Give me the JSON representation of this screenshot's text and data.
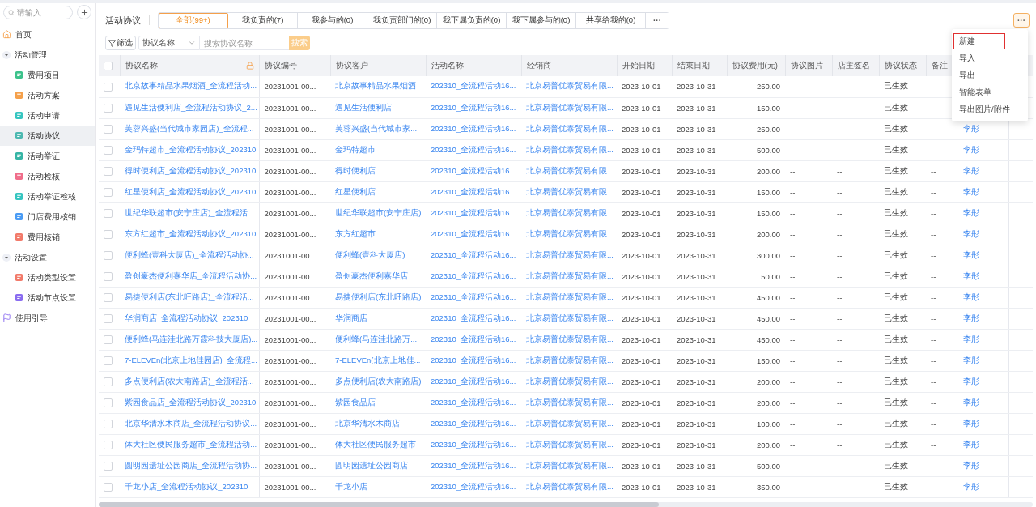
{
  "sidebar": {
    "search": {
      "placeholder": "请输入"
    },
    "items": [
      {
        "kind": "home",
        "label": "首页",
        "selected": false
      },
      {
        "kind": "group",
        "label": "活动管理",
        "expanded": true,
        "children": [
          {
            "label": "费用项目",
            "color": "#3cc28b",
            "selected": false
          },
          {
            "label": "活动方案",
            "color": "#f5a04a",
            "selected": false
          },
          {
            "label": "活动申请",
            "color": "#36c5c0",
            "selected": false
          },
          {
            "label": "活动协议",
            "color": "#4bb8b0",
            "selected": true
          },
          {
            "label": "活动举证",
            "color": "#36b5a5",
            "selected": false
          },
          {
            "label": "活动检核",
            "color": "#f06d8a",
            "selected": false
          },
          {
            "label": "活动举证检核",
            "color": "#36c5c0",
            "selected": false
          },
          {
            "label": "门店费用核销",
            "color": "#4a9cf5",
            "selected": false
          },
          {
            "label": "费用核销",
            "color": "#f27a6a",
            "selected": false
          }
        ]
      },
      {
        "kind": "group",
        "label": "活动设置",
        "expanded": true,
        "children": [
          {
            "label": "活动类型设置",
            "color": "#f27a6a",
            "selected": false
          },
          {
            "label": "活动节点设置",
            "color": "#8a6cf0",
            "selected": false
          }
        ]
      },
      {
        "kind": "guide",
        "label": "使用引导",
        "selected": false
      }
    ]
  },
  "header": {
    "title": "活动协议",
    "tabs": [
      {
        "label": "全部(99+)",
        "selected": true
      },
      {
        "label": "我负责的(7)",
        "selected": false
      },
      {
        "label": "我参与的(0)",
        "selected": false
      },
      {
        "label": "我负责部门的(0)",
        "selected": false
      },
      {
        "label": "我下属负责的(0)",
        "selected": false
      },
      {
        "label": "我下属参与的(0)",
        "selected": false
      },
      {
        "label": "共享给我的(0)",
        "selected": false
      }
    ],
    "more_tab": "···",
    "more_button": {
      "label": "···",
      "active": true
    }
  },
  "menu": {
    "items": [
      {
        "label": "新建",
        "highlighted": true
      },
      {
        "label": "导入",
        "highlighted": false
      },
      {
        "label": "导出",
        "highlighted": false
      },
      {
        "label": "智能表单",
        "highlighted": false
      },
      {
        "label": "导出图片/附件",
        "highlighted": false
      }
    ]
  },
  "filter": {
    "filter_button": "筛选",
    "field_select": "协议名称",
    "search": {
      "placeholder": "搜索协议名称"
    },
    "search_button": "搜索"
  },
  "table": {
    "header_checked": false,
    "columns": [
      {
        "label": "协议名称",
        "kind": "link",
        "locked": true
      },
      {
        "label": "协议编号",
        "kind": "text"
      },
      {
        "label": "协议客户",
        "kind": "link"
      },
      {
        "label": "活动名称",
        "kind": "link"
      },
      {
        "label": "经销商",
        "kind": "link"
      },
      {
        "label": "开始日期",
        "kind": "text"
      },
      {
        "label": "结束日期",
        "kind": "text"
      },
      {
        "label": "协议费用(元)",
        "kind": "number"
      },
      {
        "label": "协议图片",
        "kind": "text"
      },
      {
        "label": "店主签名",
        "kind": "text"
      },
      {
        "label": "协议状态",
        "kind": "text"
      },
      {
        "label": "备注",
        "kind": "text"
      }
    ],
    "rows": [
      {
        "checked": false,
        "cells": [
          "北京故事精品水果烟酒_全流程活动...",
          "20231001-00...",
          "北京故事精品水果烟酒",
          "202310_全流程活动16...",
          "北京易普优泰贸易有限...",
          "2023-10-01",
          "2023-10-31",
          "250.00",
          "--",
          "--",
          "已生效",
          "--"
        ]
      },
      {
        "checked": false,
        "cells": [
          "遇见生活便利店_全流程活动协议_2...",
          "20231001-00...",
          "遇见生活便利店",
          "202310_全流程活动16...",
          "北京易普优泰贸易有限...",
          "2023-10-01",
          "2023-10-31",
          "150.00",
          "--",
          "--",
          "已生效",
          "--"
        ]
      },
      {
        "checked": false,
        "cells": [
          "芙蓉兴盛(当代城市家园店)_全流程...",
          "20231001-00...",
          "芙蓉兴盛(当代城市家...",
          "202310_全流程活动16...",
          "北京易普优泰贸易有限...",
          "2023-10-01",
          "2023-10-31",
          "250.00",
          "--",
          "--",
          "已生效",
          "--"
        ],
        "column_14": "李彤"
      },
      {
        "checked": false,
        "cells": [
          "金玛特超市_全流程活动协议_202310",
          "20231001-00...",
          "金玛特超市",
          "202310_全流程活动16...",
          "北京易普优泰贸易有限...",
          "2023-10-01",
          "2023-10-31",
          "500.00",
          "--",
          "--",
          "已生效",
          "--"
        ],
        "column_14": "李彤"
      },
      {
        "checked": false,
        "cells": [
          "得时便利店_全流程活动协议_202310",
          "20231001-00...",
          "得时便利店",
          "202310_全流程活动16...",
          "北京易普优泰贸易有限...",
          "2023-10-01",
          "2023-10-31",
          "200.00",
          "--",
          "--",
          "已生效",
          "--"
        ],
        "column_14": "李彤"
      },
      {
        "checked": false,
        "cells": [
          "红星便利店_全流程活动协议_202310",
          "20231001-00...",
          "红星便利店",
          "202310_全流程活动16...",
          "北京易普优泰贸易有限...",
          "2023-10-01",
          "2023-10-31",
          "150.00",
          "--",
          "--",
          "已生效",
          "--"
        ],
        "column_14": "李彤"
      },
      {
        "checked": false,
        "cells": [
          "世纪华联超市(安宁庄店)_全流程活...",
          "20231001-00...",
          "世纪华联超市(安宁庄店)",
          "202310_全流程活动16...",
          "北京易普优泰贸易有限...",
          "2023-10-01",
          "2023-10-31",
          "150.00",
          "--",
          "--",
          "已生效",
          "--"
        ],
        "column_14": "李彤"
      },
      {
        "checked": false,
        "cells": [
          "东方红超市_全流程活动协议_202310",
          "20231001-00...",
          "东方红超市",
          "202310_全流程活动16...",
          "北京易普优泰贸易有限...",
          "2023-10-01",
          "2023-10-31",
          "200.00",
          "--",
          "--",
          "已生效",
          "--"
        ],
        "column_14": "李彤"
      },
      {
        "checked": false,
        "cells": [
          "便利蜂(壹科大厦店)_全流程活动协...",
          "20231001-00...",
          "便利蜂(壹科大厦店)",
          "202310_全流程活动16...",
          "北京易普优泰贸易有限...",
          "2023-10-01",
          "2023-10-31",
          "300.00",
          "--",
          "--",
          "已生效",
          "--"
        ],
        "column_14": "李彤"
      },
      {
        "checked": false,
        "cells": [
          "盈创豪杰便利嘉华店_全流程活动协...",
          "20231001-00...",
          "盈创豪杰便利嘉华店",
          "202310_全流程活动16...",
          "北京易普优泰贸易有限...",
          "2023-10-01",
          "2023-10-31",
          "50.00",
          "--",
          "--",
          "已生效",
          "--"
        ],
        "column_14": "李彤"
      },
      {
        "checked": false,
        "cells": [
          "易捷便利店(东北旺路店)_全流程活...",
          "20231001-00...",
          "易捷便利店(东北旺路店)",
          "202310_全流程活动16...",
          "北京易普优泰贸易有限...",
          "2023-10-01",
          "2023-10-31",
          "450.00",
          "--",
          "--",
          "已生效",
          "--"
        ],
        "column_14": "李彤"
      },
      {
        "checked": false,
        "cells": [
          "华润商店_全流程活动协议_202310",
          "20231001-00...",
          "华润商店",
          "202310_全流程活动16...",
          "北京易普优泰贸易有限...",
          "2023-10-01",
          "2023-10-31",
          "450.00",
          "--",
          "--",
          "已生效",
          "--"
        ],
        "column_14": "李彤"
      },
      {
        "checked": false,
        "cells": [
          "便利蜂(马连洼北路万霞科技大厦店)...",
          "20231001-00...",
          "便利蜂(马连洼北路万...",
          "202310_全流程活动16...",
          "北京易普优泰贸易有限...",
          "2023-10-01",
          "2023-10-31",
          "450.00",
          "--",
          "--",
          "已生效",
          "--"
        ],
        "column_14": "李彤"
      },
      {
        "checked": false,
        "cells": [
          "7-ELEVEn(北京上地佳园店)_全流程...",
          "20231001-00...",
          "7-ELEVEn(北京上地佳...",
          "202310_全流程活动16...",
          "北京易普优泰贸易有限...",
          "2023-10-01",
          "2023-10-31",
          "150.00",
          "--",
          "--",
          "已生效",
          "--"
        ],
        "column_14": "李彤"
      },
      {
        "checked": false,
        "cells": [
          "多点便利店(农大南路店)_全流程活...",
          "20231001-00...",
          "多点便利店(农大南路店)",
          "202310_全流程活动16...",
          "北京易普优泰贸易有限...",
          "2023-10-01",
          "2023-10-31",
          "200.00",
          "--",
          "--",
          "已生效",
          "--"
        ],
        "column_14": "李彤"
      },
      {
        "checked": false,
        "cells": [
          "紫园食品店_全流程活动协议_202310",
          "20231001-00...",
          "紫园食品店",
          "202310_全流程活动16...",
          "北京易普优泰贸易有限...",
          "2023-10-01",
          "2023-10-31",
          "200.00",
          "--",
          "--",
          "已生效",
          "--"
        ],
        "column_14": "李彤"
      },
      {
        "checked": false,
        "cells": [
          "北京华清水木商店_全流程活动协议...",
          "20231001-00...",
          "北京华清水木商店",
          "202310_全流程活动16...",
          "北京易普优泰贸易有限...",
          "2023-10-01",
          "2023-10-31",
          "100.00",
          "--",
          "--",
          "已生效",
          "--"
        ],
        "column_14": "李彤"
      },
      {
        "checked": false,
        "cells": [
          "体大社区便民服务超市_全流程活动...",
          "20231001-00...",
          "体大社区便民服务超市",
          "202310_全流程活动16...",
          "北京易普优泰贸易有限...",
          "2023-10-01",
          "2023-10-31",
          "200.00",
          "--",
          "--",
          "已生效",
          "--"
        ],
        "column_14": "李彤"
      },
      {
        "checked": false,
        "cells": [
          "圆明园遗址公园商店_全流程活动协...",
          "20231001-00...",
          "圆明园遗址公园商店",
          "202310_全流程活动16...",
          "北京易普优泰贸易有限...",
          "2023-10-01",
          "2023-10-31",
          "500.00",
          "--",
          "--",
          "已生效",
          "--"
        ],
        "column_14": "李彤"
      },
      {
        "checked": false,
        "cells": [
          "千龙小店_全流程活动协议_202310",
          "20231001-00...",
          "千龙小店",
          "202310_全流程活动16...",
          "北京易普优泰贸易有限...",
          "2023-10-01",
          "2023-10-31",
          "350.00",
          "--",
          "--",
          "已生效",
          "--"
        ],
        "column_14": "李彤"
      }
    ]
  }
}
